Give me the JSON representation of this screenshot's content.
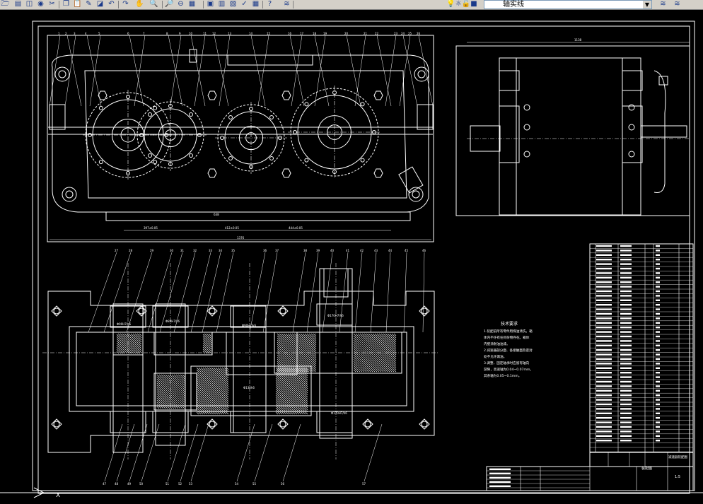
{
  "toolbar": {
    "buttons": [
      {
        "name": "open-icon",
        "glyph": "🗁"
      },
      {
        "name": "plot-icon",
        "glyph": "▤"
      },
      {
        "name": "preview-icon",
        "glyph": "◫"
      },
      {
        "name": "publish-icon",
        "glyph": "◉"
      },
      {
        "name": "cut-icon",
        "glyph": "✂"
      },
      {
        "name": "copy-icon",
        "glyph": "❐"
      },
      {
        "name": "paste-icon",
        "glyph": "📋"
      },
      {
        "name": "match-properties-icon",
        "glyph": "✎"
      },
      {
        "name": "block-editor-icon",
        "glyph": "◪"
      },
      {
        "name": "undo-icon",
        "glyph": "↶"
      },
      {
        "name": "redo-icon",
        "glyph": "↷"
      },
      {
        "name": "pan-icon",
        "glyph": "✋"
      },
      {
        "name": "zoom-realtime-icon",
        "glyph": "🔍"
      },
      {
        "name": "zoom-window-icon",
        "glyph": "🔎"
      },
      {
        "name": "zoom-previous-icon",
        "glyph": "⊖"
      },
      {
        "name": "properties-icon",
        "glyph": "▦"
      },
      {
        "name": "design-center-icon",
        "glyph": "▣"
      },
      {
        "name": "tool-palettes-icon",
        "glyph": "▥"
      },
      {
        "name": "sheet-set-icon",
        "glyph": "▧"
      },
      {
        "name": "markup-icon",
        "glyph": "✓"
      },
      {
        "name": "quick-calc-icon",
        "glyph": "▦"
      },
      {
        "name": "help-icon",
        "glyph": "?"
      },
      {
        "name": "layer-manager-icon",
        "glyph": "≋"
      }
    ],
    "layer": {
      "current": "轴实线",
      "state_icons": "💡☼🔓■"
    },
    "layer_tools": [
      "≋",
      "≋"
    ]
  },
  "drawing": {
    "notes_title": "技术要求",
    "notes": [
      "1.装配前所有零件用煤油清洗，箱",
      "体内不许有任何杂物存在。箱体",
      "内壁涂耐油油漆。",
      "2.减速器剖分面、各接触面及密封",
      "处不允许漏油。",
      "3.调整、固定轴承时应留有轴向",
      "游隙，高速轴为0.04~0.07mm，",
      "其余轴为0.05~0.1mm。"
    ],
    "dims": {
      "overall_width": "1376",
      "seg1": "397±0.05",
      "seg2": "412±0.05",
      "seg3": "444±0.05",
      "center": "638",
      "side_width": "1138",
      "pitch_d": "Φ130h6"
    },
    "title_block": {
      "name": "减速器装配图",
      "designation": "装配图",
      "scale": "1:5"
    },
    "hp_note": "轴实线"
  }
}
